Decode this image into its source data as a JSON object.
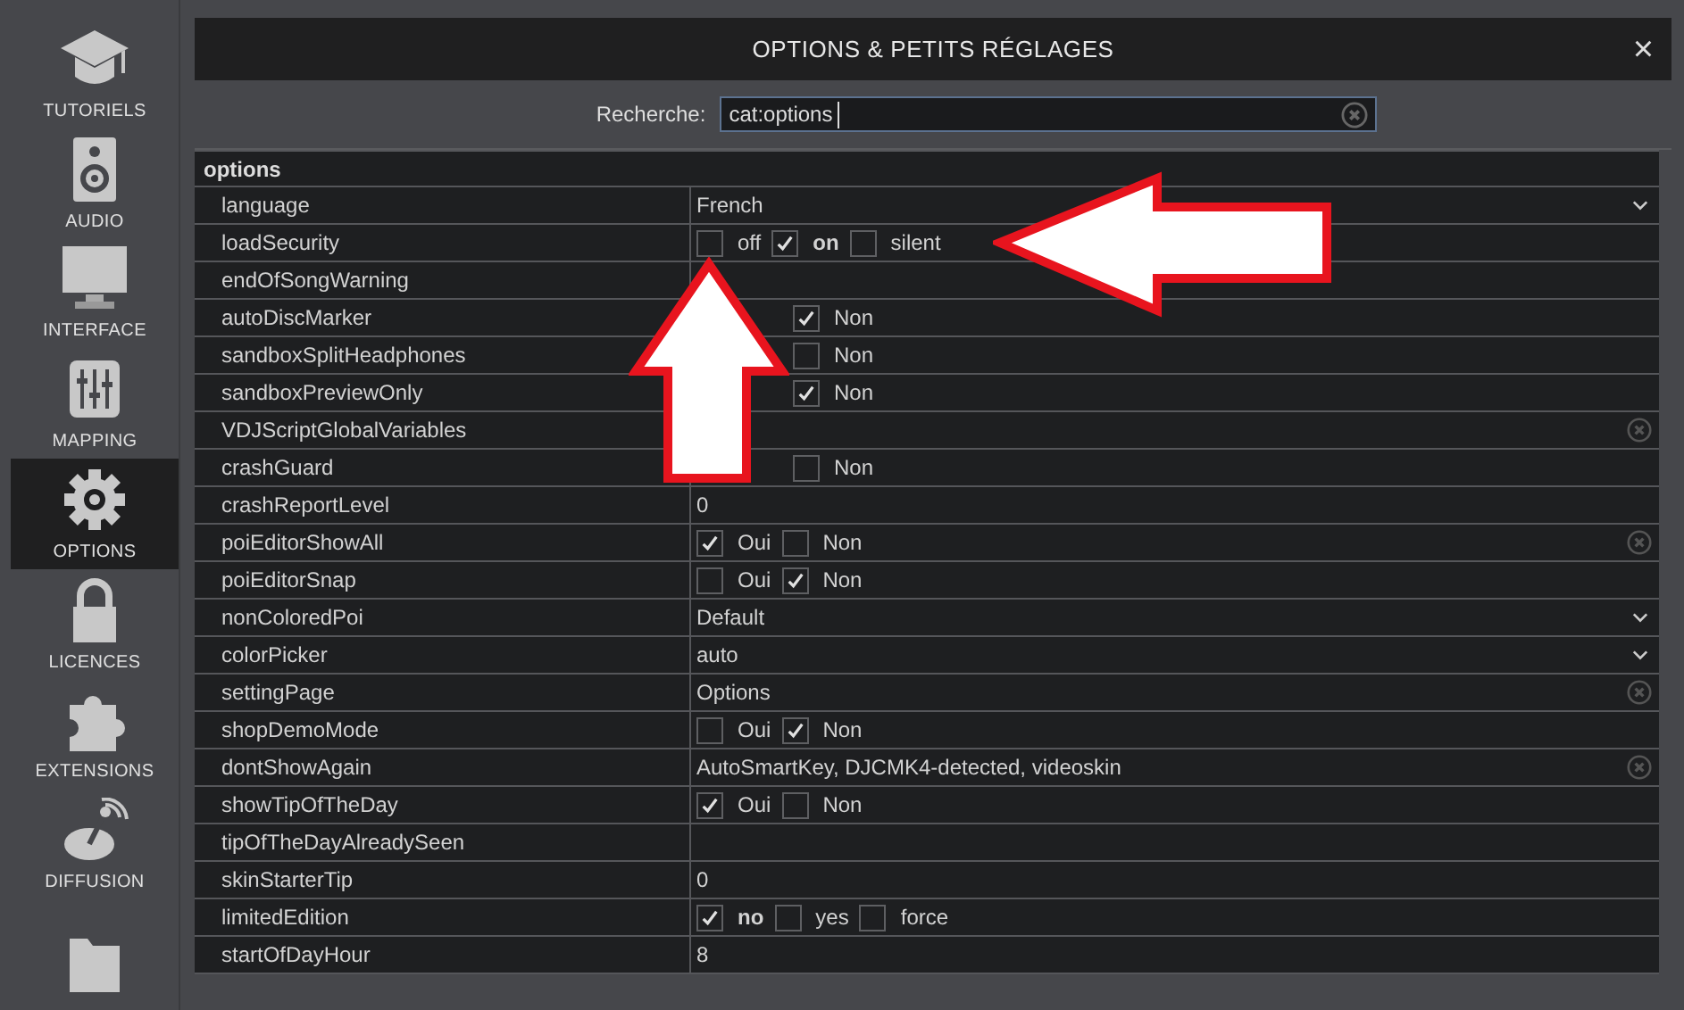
{
  "sidebar": {
    "items": [
      {
        "label": "TUTORIELS",
        "selected": false
      },
      {
        "label": "AUDIO",
        "selected": false
      },
      {
        "label": "INTERFACE",
        "selected": false
      },
      {
        "label": "MAPPING",
        "selected": false
      },
      {
        "label": "OPTIONS",
        "selected": true
      },
      {
        "label": "LICENCES",
        "selected": false
      },
      {
        "label": "EXTENSIONS",
        "selected": false
      },
      {
        "label": "DIFFUSION",
        "selected": false
      },
      {
        "selected": false
      }
    ]
  },
  "window": {
    "title": "OPTIONS & PETITS RÉGLAGES",
    "close": "×"
  },
  "search": {
    "label": "Recherche:",
    "value": "cat:options"
  },
  "table": {
    "group": "options",
    "rows": [
      {
        "name": "language",
        "kind": "select",
        "value": "French"
      },
      {
        "name": "loadSecurity",
        "kind": "choices",
        "options": [
          {
            "label": "off",
            "checked": false,
            "default": false
          },
          {
            "label": "on",
            "checked": true,
            "default": true
          },
          {
            "label": "silent",
            "checked": false,
            "default": false
          }
        ]
      },
      {
        "name": "endOfSongWarning",
        "kind": "covered"
      },
      {
        "name": "autoDiscMarker",
        "kind": "covered_choices",
        "options": [
          {
            "label": "Non",
            "checked": true
          }
        ]
      },
      {
        "name": "sandboxSplitHeadphones",
        "kind": "covered_choices",
        "options": [
          {
            "label": "Non",
            "checked": false
          }
        ]
      },
      {
        "name": "sandboxPreviewOnly",
        "kind": "covered_choices",
        "options": [
          {
            "label": "Non",
            "checked": true
          }
        ]
      },
      {
        "name": "VDJScriptGlobalVariables",
        "kind": "text_clear"
      },
      {
        "name": "crashGuard",
        "kind": "covered_choices",
        "options": [
          {
            "label": "Non",
            "checked": false
          }
        ]
      },
      {
        "name": "crashReportLevel",
        "kind": "text",
        "value": "0"
      },
      {
        "name": "poiEditorShowAll",
        "kind": "choices_clear",
        "options": [
          {
            "label": "Oui",
            "checked": true
          },
          {
            "label": "Non",
            "checked": false
          }
        ]
      },
      {
        "name": "poiEditorSnap",
        "kind": "choices",
        "options": [
          {
            "label": "Oui",
            "checked": false
          },
          {
            "label": "Non",
            "checked": true
          }
        ]
      },
      {
        "name": "nonColoredPoi",
        "kind": "select",
        "value": "Default"
      },
      {
        "name": "colorPicker",
        "kind": "select",
        "value": "auto"
      },
      {
        "name": "settingPage",
        "kind": "text_clear",
        "value": "Options"
      },
      {
        "name": "shopDemoMode",
        "kind": "choices",
        "options": [
          {
            "label": "Oui",
            "checked": false
          },
          {
            "label": "Non",
            "checked": true
          }
        ]
      },
      {
        "name": "dontShowAgain",
        "kind": "text_clear",
        "value": "AutoSmartKey, DJCMK4-detected, videoskin"
      },
      {
        "name": "showTipOfTheDay",
        "kind": "choices",
        "options": [
          {
            "label": "Oui",
            "checked": true
          },
          {
            "label": "Non",
            "checked": false
          }
        ]
      },
      {
        "name": "tipOfTheDayAlreadySeen",
        "kind": "text"
      },
      {
        "name": "skinStarterTip",
        "kind": "text",
        "value": "0"
      },
      {
        "name": "limitedEdition",
        "kind": "choices",
        "options": [
          {
            "label": "no",
            "checked": true,
            "default": true
          },
          {
            "label": "yes",
            "checked": false,
            "default": false
          },
          {
            "label": "force",
            "checked": false,
            "default": false
          }
        ]
      },
      {
        "name": "startOfDayHour",
        "kind": "text",
        "value": "8"
      }
    ]
  }
}
